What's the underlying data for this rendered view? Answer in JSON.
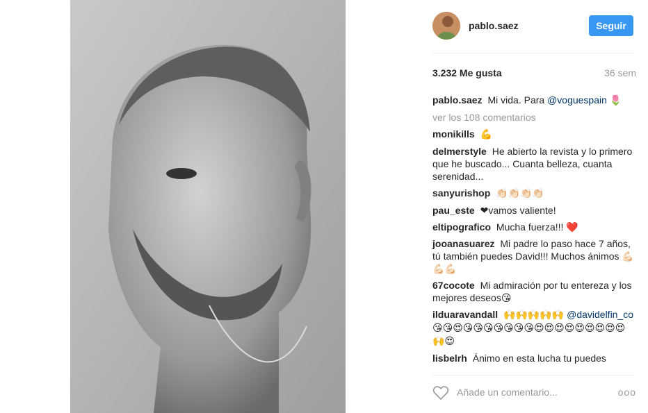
{
  "post": {
    "username": "pablo.saez",
    "follow_label": "Seguir",
    "likes": "3.232 Me gusta",
    "time_ago": "36 sem"
  },
  "caption": {
    "user": "pablo.saez",
    "text": "Mi vida. Para",
    "mention": "@voguespain",
    "emoji": "🌷"
  },
  "view_all": "ver los 108 comentarios",
  "comments": [
    {
      "user": "monikills",
      "text": "💪"
    },
    {
      "user": "delmerstyle",
      "text": "He abierto la revista y lo primero que he buscado... Cuanta belleza, cuanta serenidad..."
    },
    {
      "user": "sanyurishop",
      "text": "👏🏻👏🏻👏🏻👏🏻"
    },
    {
      "user": "pau_este",
      "text": "❤vamos valiente!"
    },
    {
      "user": "eltipografico",
      "text": "Mucha fuerza!!! ❤️"
    },
    {
      "user": "jooanasuarez",
      "text": "Mi padre lo paso hace 7 años, tú también puedes David!!! Muchos ánimos 💪🏻💪🏻💪🏻"
    },
    {
      "user": "67cocote",
      "text": "Mi admiración por tu entereza y los mejores deseos😘"
    },
    {
      "user": "ilduaravandall",
      "text": "🙌🙌🙌🙌🙌",
      "mention": "@davidelfin_co",
      "text2": "😘😘😍😘😘😘😘😘😘😘😍😍😍😍😍😍😍😍😍🙌😍"
    },
    {
      "user": "lisbelrh",
      "text": "Ánimo en esta lucha tu puedes"
    }
  ],
  "footer": {
    "add_comment_placeholder": "Añade un comentario...",
    "more_label": "ooo"
  },
  "icons": {
    "like": "heart-outline-icon",
    "more": "more-options-icon"
  },
  "colors": {
    "accent": "#3897f0",
    "muted": "#999999",
    "mention": "#003569"
  }
}
